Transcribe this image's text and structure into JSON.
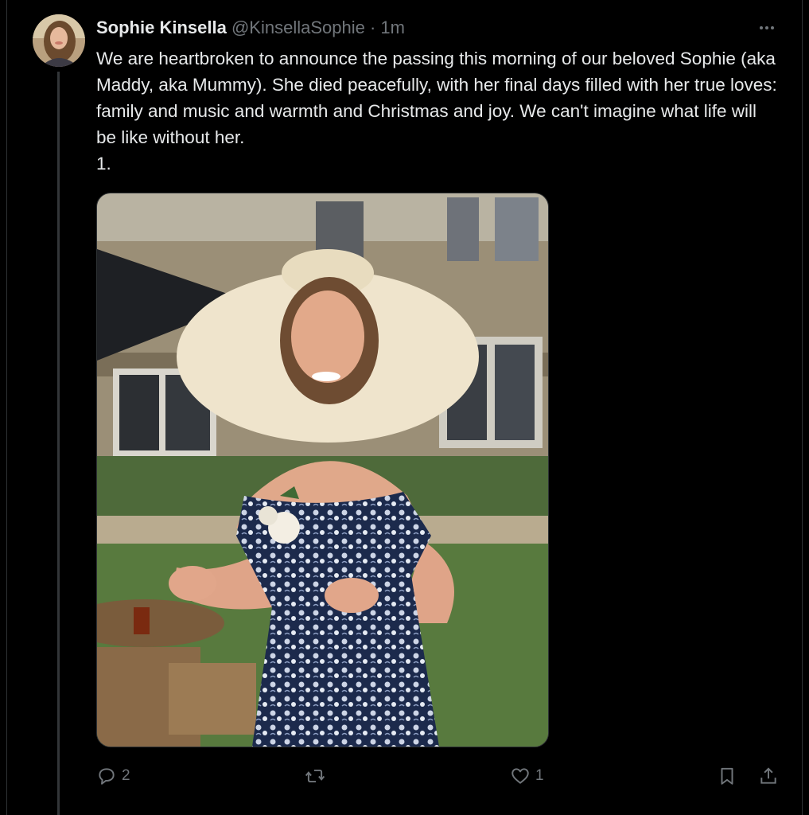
{
  "author": {
    "display_name": "Sophie Kinsella",
    "handle": "@KinsellaSophie",
    "separator": "·",
    "time": "1m"
  },
  "tweet": {
    "text": "We are heartbroken to announce the passing this morning of our beloved Sophie (aka Maddy, aka Mummy). She died peacefully, with her final days filled with her true loves: family and music and warmth and Christmas and joy. We can't imagine what life will be like without her.\n1."
  },
  "actions": {
    "reply_count": "2",
    "repost_count": "",
    "like_count": "1"
  },
  "icons": {
    "more": "more-horizontal-icon",
    "reply": "reply-icon",
    "repost": "repost-icon",
    "like": "heart-icon",
    "bookmark": "bookmark-icon",
    "share": "share-icon"
  },
  "colors": {
    "background": "#000000",
    "text_primary": "#e7e9ea",
    "text_secondary": "#71767b",
    "border": "#2f3336"
  }
}
